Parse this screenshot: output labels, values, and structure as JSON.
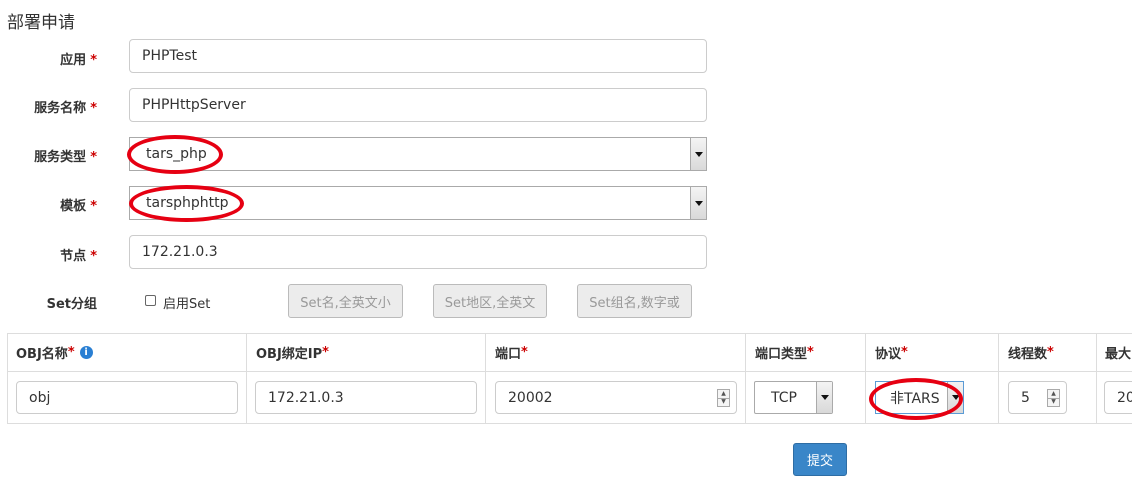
{
  "page": {
    "title": "部署申请"
  },
  "form": {
    "app": {
      "label": "应用",
      "required": "*",
      "value": "PHPTest"
    },
    "server_name": {
      "label": "服务名称",
      "required": "*",
      "value": "PHPHttpServer"
    },
    "server_type": {
      "label": "服务类型",
      "required": "*",
      "value": "tars_php"
    },
    "template": {
      "label": "模板",
      "required": "*",
      "value": "tarsphphttp"
    },
    "node": {
      "label": "节点",
      "required": "*",
      "value": "172.21.0.3"
    },
    "set_group": {
      "label": "Set分组",
      "enable_label": "启用Set",
      "set_name_placeholder": "Set名,全英文小",
      "set_area_placeholder": "Set地区,全英文",
      "set_group_placeholder": "Set组名,数字或"
    }
  },
  "obj_table": {
    "headers": {
      "obj_name": "OBJ名称",
      "bind_ip": "OBJ绑定IP",
      "port": "端口",
      "port_type": "端口类型",
      "protocol": "协议",
      "threads": "线程数",
      "max": "最大"
    },
    "required": "*",
    "info_icon": "i",
    "row": {
      "obj_name": "obj",
      "bind_ip": "172.21.0.3",
      "port": "20002",
      "port_type": "TCP",
      "protocol": "非TARS",
      "threads": "5",
      "max": "20"
    }
  },
  "actions": {
    "submit_label": "提交"
  },
  "colors": {
    "required": "#cc0000",
    "annotation": "#e60012",
    "primary": "#3a86c8"
  }
}
